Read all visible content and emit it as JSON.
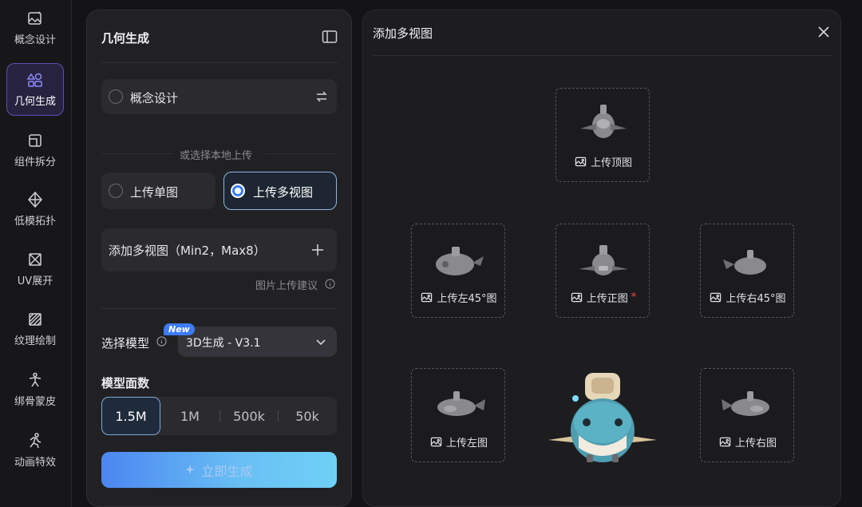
{
  "sidebar": {
    "items": [
      {
        "label": "概念设计",
        "icon": "image-sparkle-icon"
      },
      {
        "label": "几何生成",
        "icon": "shapes-icon",
        "active": true
      },
      {
        "label": "组件拆分",
        "icon": "split-box-icon"
      },
      {
        "label": "低模拓扑",
        "icon": "diamond-mesh-icon"
      },
      {
        "label": "UV展开",
        "icon": "uv-unwrap-icon"
      },
      {
        "label": "纹理绘制",
        "icon": "texture-paint-icon"
      },
      {
        "label": "绑骨蒙皮",
        "icon": "rigging-figure-icon"
      },
      {
        "label": "动画特效",
        "icon": "running-figure-icon"
      }
    ]
  },
  "panel": {
    "title": "几何生成",
    "concept_option": "概念设计",
    "or_text": "或选择本地上传",
    "upload_single": "上传单图",
    "upload_multi": "上传多视图",
    "upload_multi_selected": true,
    "add_multiview": "添加多视图（Min2，Max8）",
    "upload_tips": "图片上传建议",
    "model_label": "选择模型",
    "new_badge": "New",
    "model_value": "3D生成 - V3.1",
    "face_count_label": "模型面数",
    "face_options": [
      "1.5M",
      "1M",
      "500k",
      "50k"
    ],
    "face_selected": "1.5M",
    "generate": "立即生成"
  },
  "dialog": {
    "title": "添加多视图",
    "slots": {
      "top": "上传顶图",
      "left45": "上传左45°图",
      "front": "上传正图",
      "front_required": "*",
      "right45": "上传右45°图",
      "left": "上传左图",
      "right": "上传右图"
    }
  },
  "colors": {
    "accent": "#3b7bff",
    "active_rail": "#5a4fb0",
    "required": "#ff4d4f"
  }
}
